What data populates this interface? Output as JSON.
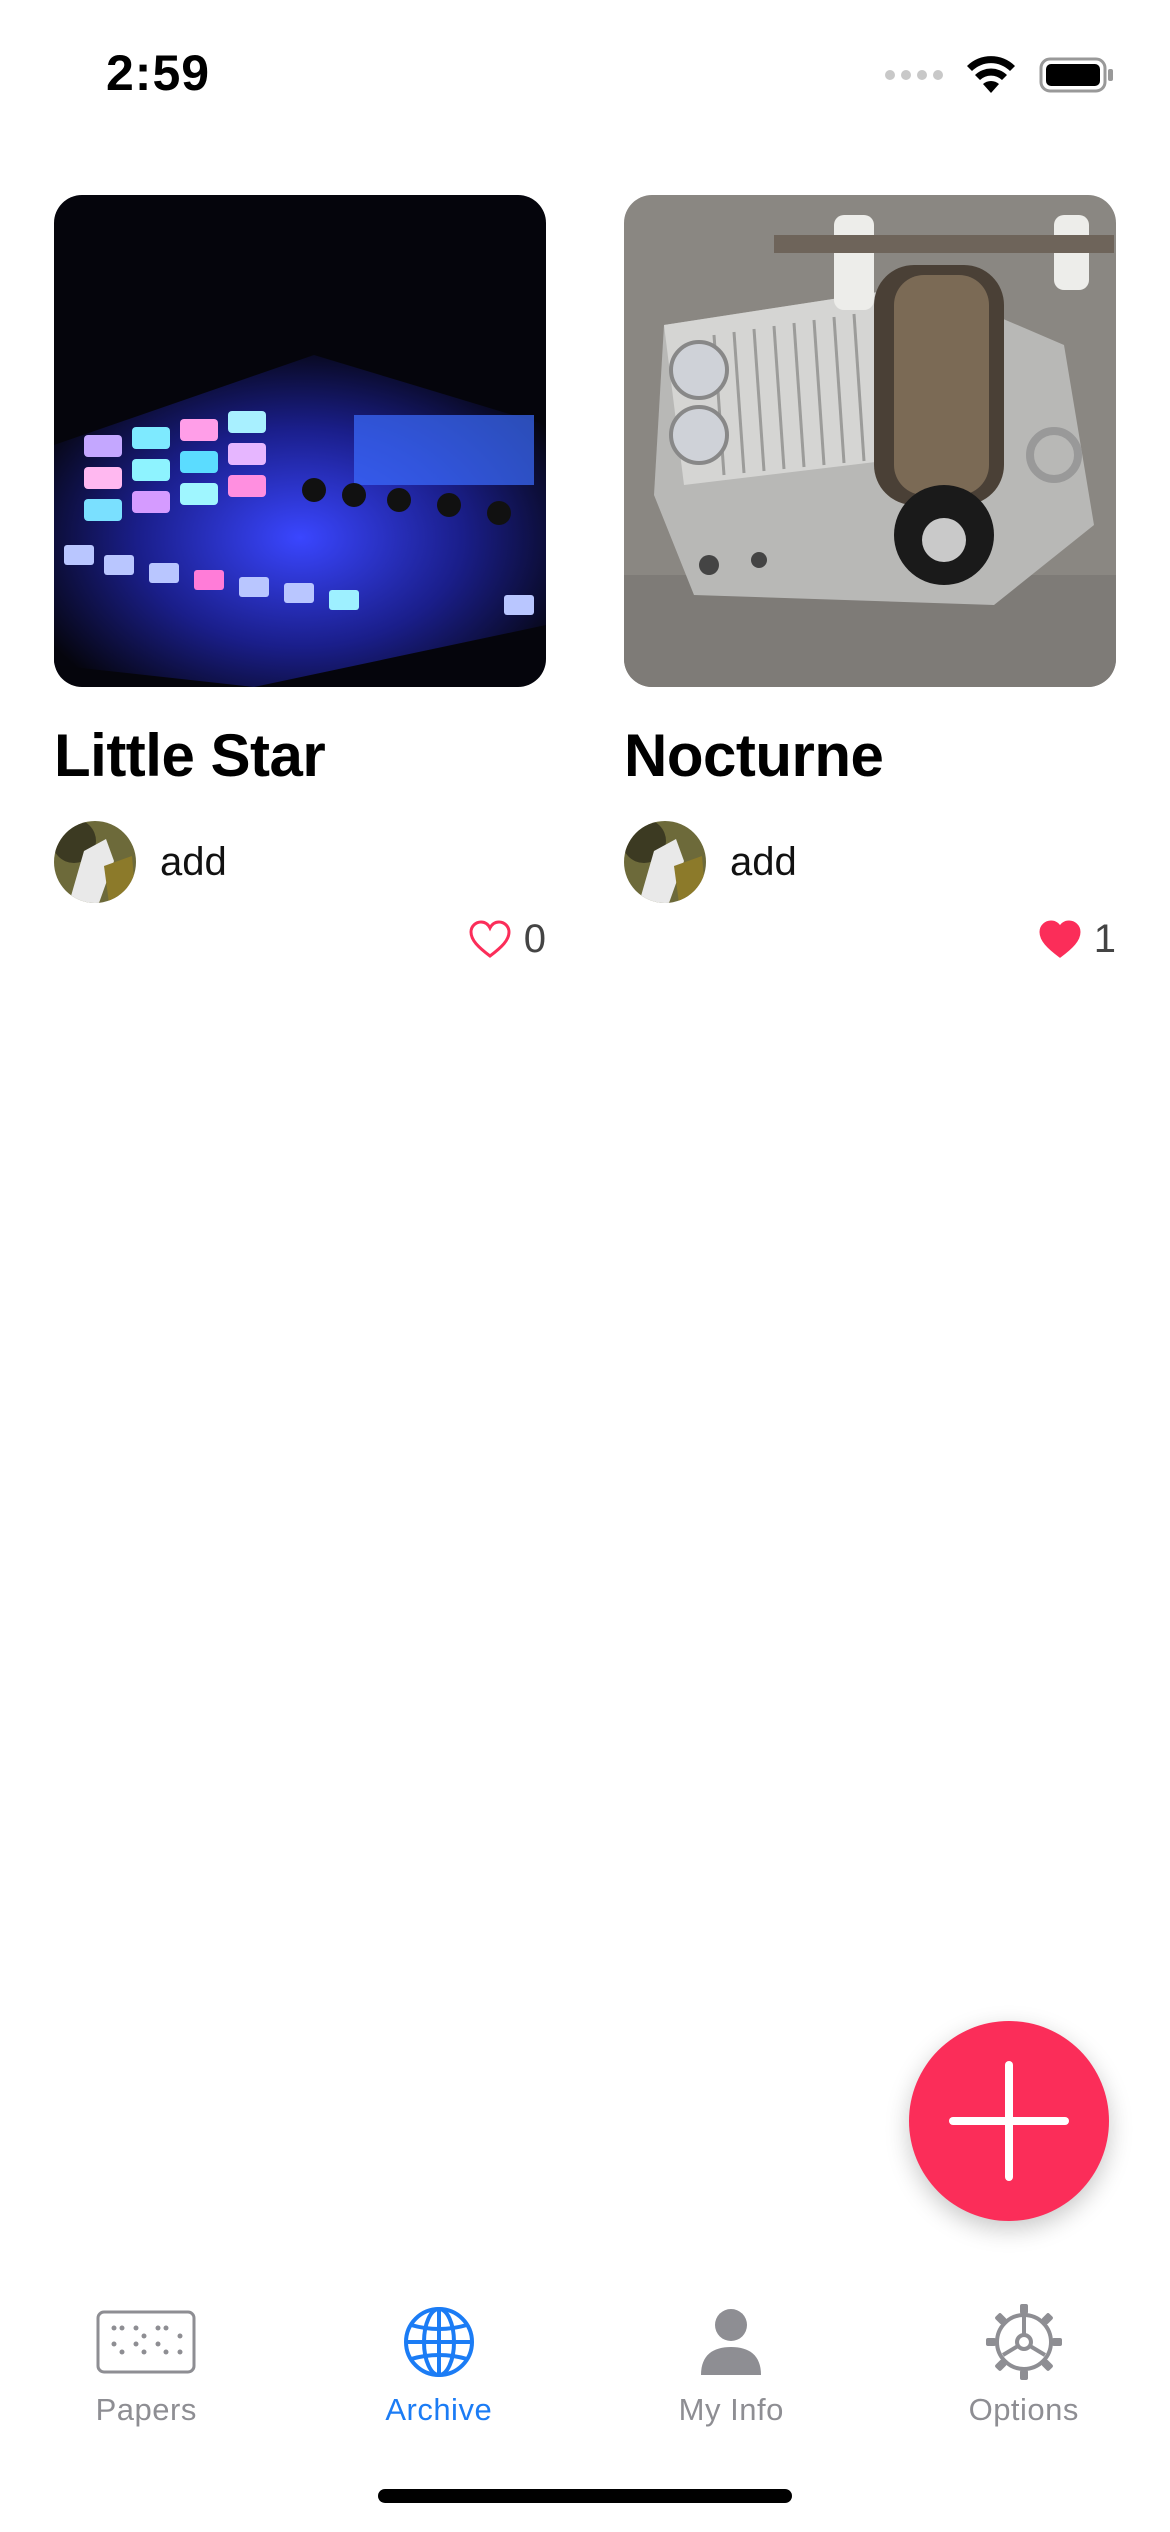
{
  "status_bar": {
    "time": "2:59",
    "icons": [
      "cellular-signal-icon",
      "wifi-icon",
      "battery-icon"
    ]
  },
  "cards": [
    {
      "title": "Little Star",
      "image": "drum-machine-photo",
      "author": "add",
      "avatar": "user-avatar-photo",
      "liked": false,
      "like_count": "0"
    },
    {
      "title": "Nocturne",
      "image": "music-box-photo",
      "author": "add",
      "avatar": "user-avatar-photo",
      "liked": true,
      "like_count": "1"
    }
  ],
  "fab": {
    "icon": "plus-icon",
    "color": "#fb2d59"
  },
  "tab_bar": {
    "tabs": [
      {
        "label": "Papers",
        "icon": "braille-paper-icon",
        "active": false
      },
      {
        "label": "Archive",
        "icon": "globe-icon",
        "active": true
      },
      {
        "label": "My Info",
        "icon": "person-icon",
        "active": false
      },
      {
        "label": "Options",
        "icon": "gear-icon",
        "active": false
      }
    ],
    "active_color": "#1b7cf5",
    "inactive_color": "#8e8e93"
  }
}
